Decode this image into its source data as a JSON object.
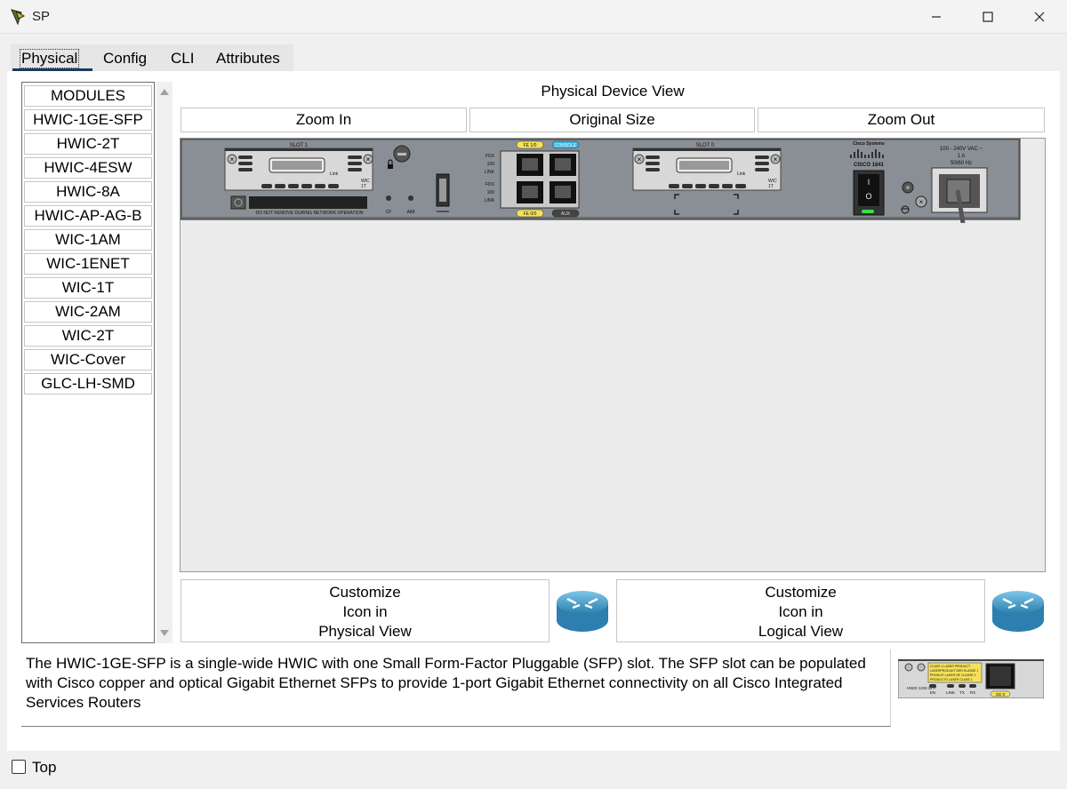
{
  "window": {
    "title": "SP"
  },
  "tabs": [
    {
      "label": "Physical",
      "active": true
    },
    {
      "label": "Config",
      "active": false
    },
    {
      "label": "CLI",
      "active": false
    },
    {
      "label": "Attributes",
      "active": false
    }
  ],
  "modules": [
    "MODULES",
    "HWIC-1GE-SFP",
    "HWIC-2T",
    "HWIC-4ESW",
    "HWIC-8A",
    "HWIC-AP-AG-B",
    "WIC-1AM",
    "WIC-1ENET",
    "WIC-1T",
    "WIC-2AM",
    "WIC-2T",
    "WIC-Cover",
    "GLC-LH-SMD"
  ],
  "physical_view": {
    "title": "Physical Device View",
    "zoom_in": "Zoom In",
    "original_size": "Original Size",
    "zoom_out": "Zoom Out"
  },
  "device": {
    "slot1_label": "SLOT 1",
    "slot0_label": "SLOT 0",
    "do_not_remove": "DO NOT REMOVE DURING NETWORK OPERATION",
    "cf_label": "CF",
    "aim_label": "AIM",
    "fdx": "FDX",
    "speed": "100",
    "link": "LINK",
    "fe10_label": "FE 1/0",
    "fe00_label": "FE 0/0",
    "console_label": "CONSOLE",
    "aux_label": "AUX",
    "brand": "Cisco Systems",
    "model": "CISCO 1841",
    "power_line1": "100 - 240V VAC ~",
    "power_line2": "1 A",
    "power_line3": "50/60 Hz",
    "wic_label": "WIC",
    "wic_sub": "1T",
    "link_label": "Link"
  },
  "customize": {
    "physical": [
      "Customize",
      "Icon in",
      "Physical View"
    ],
    "logical": [
      "Customize",
      "Icon in",
      "Logical View"
    ]
  },
  "description": "The HWIC-1GE-SFP is a single-wide HWIC with one Small Form-Factor Pluggable (SFP) slot. The SFP slot can be populated with Cisco copper and optical Gigabit Ethernet SFPs to provide 1-port Gigabit Ethernet connectivity on all Cisco Integrated Services Routers",
  "module_thumb": {
    "model": "HWIC-1GE-SFP",
    "en": "EN",
    "link": "LINK",
    "tx": "TX",
    "rx": "RX",
    "port": "GE 0",
    "laser_lines": [
      "CLASS 1 LASER PRODUCT",
      "LASERPRODUKT DER KLASSE 1",
      "PRODUIT LASER DE CLASSE 1",
      "PRODUCTO LASER CLASE 1"
    ]
  },
  "footer": {
    "top_label": "Top",
    "top_checked": false
  },
  "colors": {
    "chassis": "#6a6f74",
    "accent_tab": "#1a3a64",
    "fe_badge": "#f5e25a",
    "console_badge": "#3bb4e6"
  }
}
